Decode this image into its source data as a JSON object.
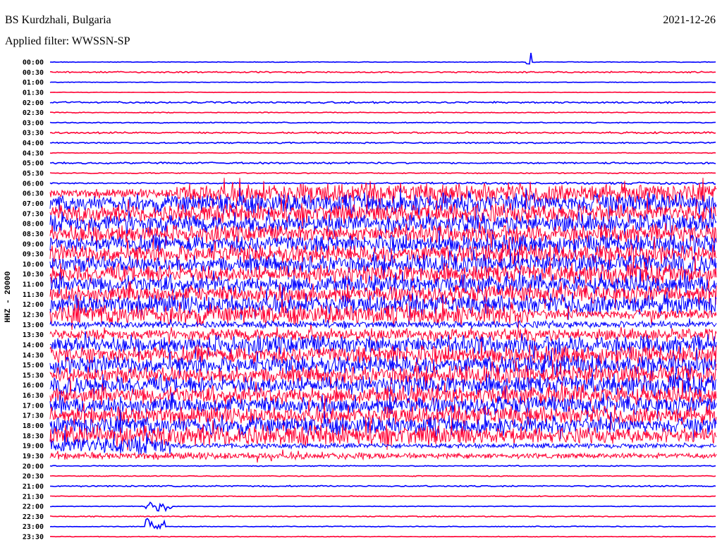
{
  "header": {
    "station": "BS Kurdzhali, Bulgaria",
    "date": "2021-12-26",
    "filter": "Applied filter: WWSSN-SP"
  },
  "chart_data": {
    "type": "line",
    "title": "BS Kurdzhali, Bulgaria",
    "subtitle": "Applied filter: WWSSN-SP",
    "ylabel": "HHZ - 20000",
    "xlabel": "",
    "minutes_per_row": 30,
    "colors": [
      "#0000ff",
      "#ff0033"
    ],
    "rows": [
      {
        "label": "00:00",
        "amp": [
          0.4,
          0.4,
          0.5
        ]
      },
      {
        "label": "00:30",
        "amp": [
          0.8,
          0.8,
          0.5
        ]
      },
      {
        "label": "01:00",
        "amp": [
          0.3,
          0.3,
          0.5
        ]
      },
      {
        "label": "01:30",
        "amp": [
          0.3,
          0.3,
          0.5
        ]
      },
      {
        "label": "02:00",
        "amp": [
          1.0,
          1.0,
          0.5
        ]
      },
      {
        "label": "02:30",
        "amp": [
          0.5,
          0.5,
          0.5
        ]
      },
      {
        "label": "03:00",
        "amp": [
          0.6,
          0.6,
          0.5
        ]
      },
      {
        "label": "03:30",
        "amp": [
          1.0,
          1.0,
          0.5
        ]
      },
      {
        "label": "04:00",
        "amp": [
          0.8,
          0.8,
          0.5
        ]
      },
      {
        "label": "04:30",
        "amp": [
          0.4,
          0.4,
          0.5
        ]
      },
      {
        "label": "05:00",
        "amp": [
          1.0,
          1.0,
          0.5
        ]
      },
      {
        "label": "05:30",
        "amp": [
          0.6,
          0.6,
          0.5
        ]
      },
      {
        "label": "06:00",
        "amp": [
          0.8,
          1.2,
          0.5
        ]
      },
      {
        "label": "06:30",
        "amp": [
          5,
          12,
          0.19
        ]
      },
      {
        "label": "07:00",
        "amp": [
          10,
          12,
          0.19
        ]
      },
      {
        "label": "07:30",
        "amp": [
          10,
          11,
          0.19
        ]
      },
      {
        "label": "08:00",
        "amp": [
          10,
          11,
          0.5
        ]
      },
      {
        "label": "08:30",
        "amp": [
          10,
          11,
          0.5
        ]
      },
      {
        "label": "09:00",
        "amp": [
          10,
          11,
          0.5
        ]
      },
      {
        "label": "09:30",
        "amp": [
          10,
          11,
          0.5
        ]
      },
      {
        "label": "10:00",
        "amp": [
          10,
          11,
          0.5
        ]
      },
      {
        "label": "10:30",
        "amp": [
          10,
          11,
          0.5
        ]
      },
      {
        "label": "11:00",
        "amp": [
          10,
          11,
          0.5
        ]
      },
      {
        "label": "11:30",
        "amp": [
          10,
          11,
          0.5
        ]
      },
      {
        "label": "12:00",
        "amp": [
          11,
          12,
          0.72
        ]
      },
      {
        "label": "12:30",
        "amp": [
          12,
          6,
          0.72
        ]
      },
      {
        "label": "13:00",
        "amp": [
          4,
          4,
          0.72
        ]
      },
      {
        "label": "13:30",
        "amp": [
          6,
          7,
          0.24
        ]
      },
      {
        "label": "14:00",
        "amp": [
          9,
          11,
          0.24
        ]
      },
      {
        "label": "14:30",
        "amp": [
          10,
          11,
          0.5
        ]
      },
      {
        "label": "15:00",
        "amp": [
          10,
          11,
          0.5
        ]
      },
      {
        "label": "15:30",
        "amp": [
          10,
          11,
          0.5
        ]
      },
      {
        "label": "16:00",
        "amp": [
          10,
          11,
          0.5
        ]
      },
      {
        "label": "16:30",
        "amp": [
          10,
          11,
          0.5
        ]
      },
      {
        "label": "17:00",
        "amp": [
          10,
          11,
          0.5
        ]
      },
      {
        "label": "17:30",
        "amp": [
          10,
          11,
          0.5
        ]
      },
      {
        "label": "18:00",
        "amp": [
          11,
          10,
          0.63
        ]
      },
      {
        "label": "18:30",
        "amp": [
          12,
          9,
          0.63
        ]
      },
      {
        "label": "19:00",
        "amp": [
          11,
          3,
          0.18
        ]
      },
      {
        "label": "19:30",
        "amp": [
          4,
          3,
          0.5
        ]
      },
      {
        "label": "20:00",
        "amp": [
          0.6,
          0.6,
          0.5
        ]
      },
      {
        "label": "20:30",
        "amp": [
          0.5,
          0.5,
          0.5
        ]
      },
      {
        "label": "21:00",
        "amp": [
          0.8,
          0.8,
          0.5
        ]
      },
      {
        "label": "21:30",
        "amp": [
          0.5,
          0.5,
          0.5
        ]
      },
      {
        "label": "22:00",
        "amp": [
          0.4,
          0.4,
          0.5
        ]
      },
      {
        "label": "22:30",
        "amp": [
          0.6,
          0.6,
          0.5
        ]
      },
      {
        "label": "23:00",
        "amp": [
          0.5,
          0.5,
          0.5
        ]
      },
      {
        "label": "23:30",
        "amp": [
          0.4,
          0.4,
          0.5
        ]
      }
    ],
    "events": [
      {
        "row": 0,
        "minute": 21.4,
        "duration": 0.3,
        "amp": 5
      },
      {
        "row": 21,
        "minute": 7.3,
        "duration": 0.4,
        "amp": 3
      },
      {
        "row": 44,
        "minute": 4.3,
        "duration": 1.2,
        "amp": 3
      },
      {
        "row": 46,
        "minute": 4.3,
        "duration": 0.9,
        "amp": 6
      }
    ]
  }
}
